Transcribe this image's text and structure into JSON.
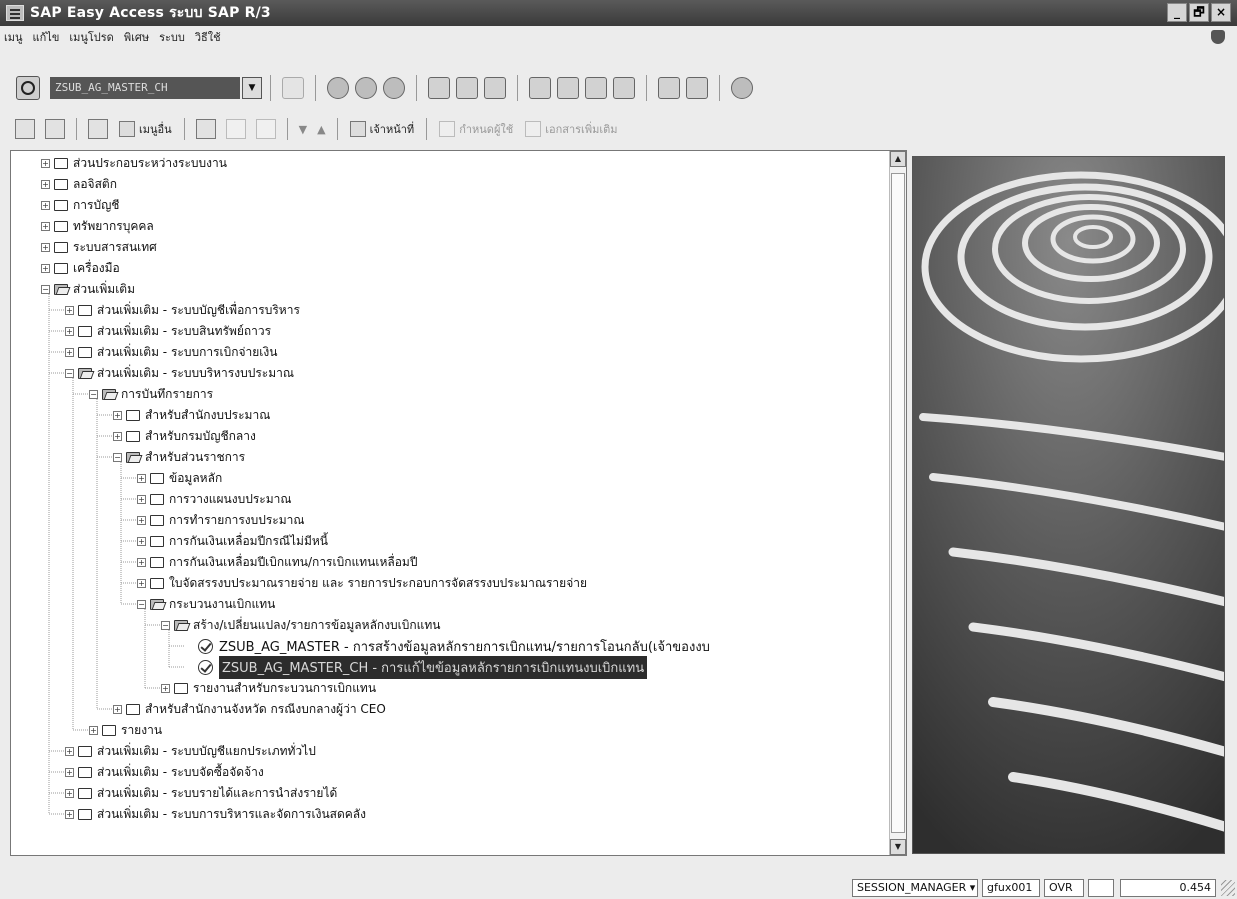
{
  "window": {
    "title": "SAP Easy Access ระบบ SAP R/3",
    "controls": {
      "minimize": "_",
      "maximize": "🗗",
      "close": "×"
    }
  },
  "menu": [
    "เมนู",
    "แก้ไข",
    "เมนูโปรด",
    "พิเศษ",
    "ระบบ",
    "วิธีใช้"
  ],
  "command_field": {
    "value": "ZSUB_AG_MASTER_CH"
  },
  "app_toolbar": {
    "menu_button": "เมนูอื่น",
    "doc_button": "เจ้าหน้าที่",
    "assign_button": "กำหนดผู้ใช้",
    "docs_button": "เอกสารเพิ่มเติม"
  },
  "tree": [
    {
      "label": "ส่วนประกอบระหว่างระบบงาน",
      "level": 0,
      "expanded": false,
      "type": "folder"
    },
    {
      "label": "ลอจิสติก",
      "level": 0,
      "expanded": false,
      "type": "folder"
    },
    {
      "label": "การบัญชี",
      "level": 0,
      "expanded": false,
      "type": "folder"
    },
    {
      "label": "ทรัพยากรบุคคล",
      "level": 0,
      "expanded": false,
      "type": "folder"
    },
    {
      "label": "ระบบสารสนเทศ",
      "level": 0,
      "expanded": false,
      "type": "folder"
    },
    {
      "label": "เครื่องมือ",
      "level": 0,
      "expanded": false,
      "type": "folder"
    },
    {
      "label": "ส่วนเพิ่มเติม",
      "level": 0,
      "expanded": true,
      "type": "folder"
    },
    {
      "label": "ส่วนเพิ่มเติม - ระบบบัญชีเพื่อการบริหาร",
      "level": 1,
      "expanded": false,
      "type": "folder"
    },
    {
      "label": "ส่วนเพิ่มเติม - ระบบสินทรัพย์ถาวร",
      "level": 1,
      "expanded": false,
      "type": "folder"
    },
    {
      "label": "ส่วนเพิ่มเติม - ระบบการเบิกจ่ายเงิน",
      "level": 1,
      "expanded": false,
      "type": "folder"
    },
    {
      "label": "ส่วนเพิ่มเติม - ระบบบริหารงบประมาณ",
      "level": 1,
      "expanded": true,
      "type": "folder"
    },
    {
      "label": "การบันทึกรายการ",
      "level": 2,
      "expanded": true,
      "type": "folder"
    },
    {
      "label": "สำหรับสำนักงบประมาณ",
      "level": 3,
      "expanded": false,
      "type": "folder"
    },
    {
      "label": "สำหรับกรมบัญชีกลาง",
      "level": 3,
      "expanded": false,
      "type": "folder"
    },
    {
      "label": "สำหรับส่วนราชการ",
      "level": 3,
      "expanded": true,
      "type": "folder"
    },
    {
      "label": "ข้อมูลหลัก",
      "level": 4,
      "expanded": false,
      "type": "folder"
    },
    {
      "label": "การวางแผนงบประมาณ",
      "level": 4,
      "expanded": false,
      "type": "folder"
    },
    {
      "label": "การทำรายการงบประมาณ",
      "level": 4,
      "expanded": false,
      "type": "folder"
    },
    {
      "label": "การกันเงินเหลื่อมปีกรณีไม่มีหนี้",
      "level": 4,
      "expanded": false,
      "type": "folder"
    },
    {
      "label": "การกันเงินเหลื่อมปีเบิกแทน/การเบิกแทนเหลื่อมปี",
      "level": 4,
      "expanded": false,
      "type": "folder"
    },
    {
      "label": "ใบจัดสรรงบประมาณรายจ่าย และ รายการประกอบการจัดสรรงบประมาณรายจ่าย",
      "level": 4,
      "expanded": false,
      "type": "folder"
    },
    {
      "label": "กระบวนงานเบิกแทน",
      "level": 4,
      "expanded": true,
      "type": "folder"
    },
    {
      "label": "สร้าง/เปลี่ยนแปลง/รายการข้อมูลหลักงบเบิกแทน",
      "level": 5,
      "expanded": true,
      "type": "folder"
    },
    {
      "label": "ZSUB_AG_MASTER - การสร้างข้อมูลหลักรายการเบิกแทน/รายการโอนกลับ(เจ้าของงบ",
      "level": 6,
      "type": "transaction"
    },
    {
      "label": "ZSUB_AG_MASTER_CH - การแก้ไขข้อมูลหลักรายการเบิกแทนงบเบิกแทน",
      "level": 6,
      "type": "transaction",
      "selected": true
    },
    {
      "label": "รายงานสำหรับกระบวนการเบิกแทน",
      "level": 5,
      "expanded": false,
      "type": "folder"
    },
    {
      "label": "สำหรับสำนักงานจังหวัด กรณีงบกลางผู้ว่า CEO",
      "level": 3,
      "expanded": false,
      "type": "folder"
    },
    {
      "label": "รายงาน",
      "level": 2,
      "expanded": false,
      "type": "folder"
    },
    {
      "label": "ส่วนเพิ่มเติม - ระบบบัญชีแยกประเภททั่วไป",
      "level": 1,
      "expanded": false,
      "type": "folder"
    },
    {
      "label": "ส่วนเพิ่มเติม - ระบบจัดซื้อจัดจ้าง",
      "level": 1,
      "expanded": false,
      "type": "folder"
    },
    {
      "label": "ส่วนเพิ่มเติม - ระบบรายได้และการนำส่งรายได้",
      "level": 1,
      "expanded": false,
      "type": "folder"
    },
    {
      "label": "ส่วนเพิ่มเติม - ระบบการบริหารและจัดการเงินสดคลัง",
      "level": 1,
      "expanded": false,
      "type": "folder"
    }
  ],
  "status": {
    "session": "SESSION_MANAGER",
    "server": "gfux001",
    "mode": "OVR",
    "time": "0.454"
  }
}
